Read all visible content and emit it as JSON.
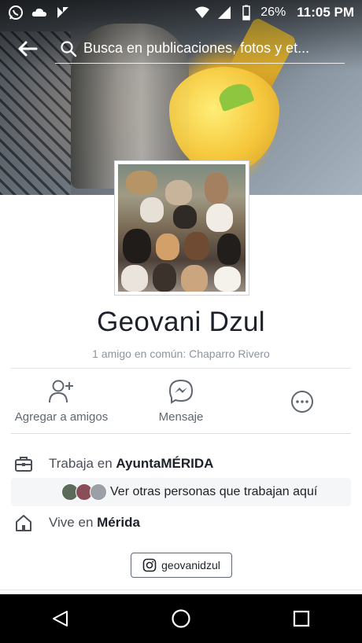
{
  "status_bar": {
    "battery": "26%",
    "time": "11:05 PM",
    "icons": [
      "whatsapp-icon",
      "cloud-icon",
      "download-icon",
      "wifi-icon",
      "signal-icon",
      "battery-icon"
    ]
  },
  "header": {
    "search_placeholder": "Busca en publicaciones, fotos y et..."
  },
  "profile": {
    "name": "Geovani Dzul",
    "mutual_friends": "1 amigo en común: Chaparro Rivero"
  },
  "actions": {
    "add_friend": "Agregar a amigos",
    "message": "Mensaje"
  },
  "info": {
    "work_prefix": "Trabaja en ",
    "work_place": "AyuntaMÉRIDA",
    "coworkers": "Ver otras personas que trabajan aquí",
    "lives_prefix": "Vive en ",
    "lives_place": "Mérida",
    "instagram": "geovanidzul"
  },
  "colors": {
    "accent": "#4b4f56",
    "name": "#1d2129",
    "muted": "#8d949e"
  }
}
